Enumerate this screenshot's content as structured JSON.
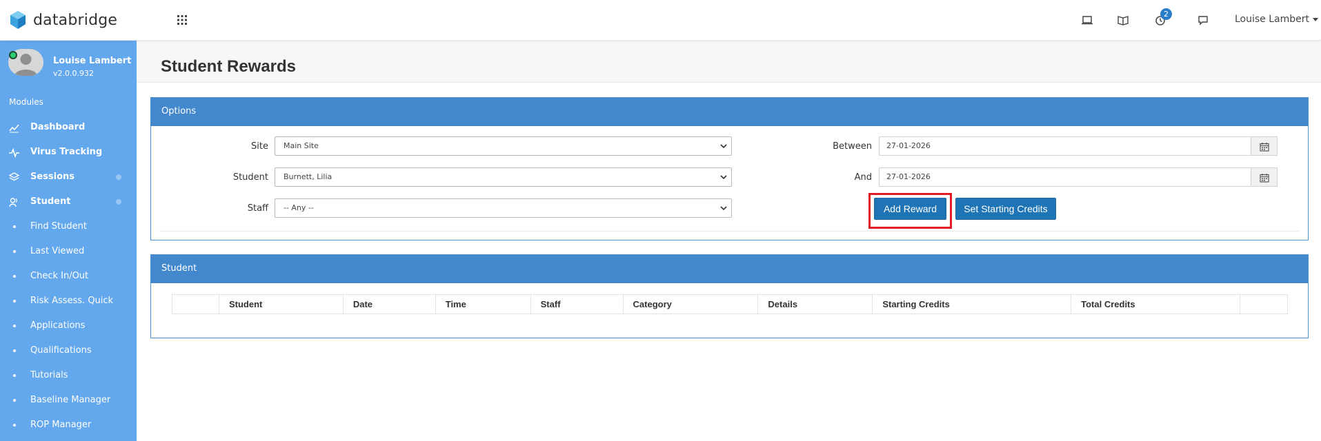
{
  "app": {
    "brand_name": "databridge"
  },
  "topbar": {
    "notification_count": "2",
    "user_name": "Louise Lambert",
    "icons": [
      "grid-icon",
      "laptop-icon",
      "book-icon",
      "clock-icon",
      "chat-icon"
    ]
  },
  "sidebar": {
    "profile_name": "Louise Lambert",
    "version": "v2.0.0.932",
    "modules_label": "Modules",
    "items": [
      {
        "label": "Dashboard",
        "icon": "chart-line-icon"
      },
      {
        "label": "Virus Tracking",
        "icon": "pulse-icon"
      },
      {
        "label": "Sessions",
        "icon": "layers-icon"
      },
      {
        "label": "Student",
        "icon": "users-icon"
      }
    ],
    "sub_items": [
      "Find Student",
      "Last Viewed",
      "Check In/Out",
      "Risk Assess. Quick",
      "Applications",
      "Qualifications",
      "Tutorials",
      "Baseline Manager",
      "ROP Manager"
    ]
  },
  "page": {
    "title": "Student Rewards"
  },
  "options": {
    "heading": "Options",
    "site_label": "Site",
    "site_value": "Main Site",
    "student_label": "Student",
    "student_value": "Burnett, Lilia",
    "staff_label": "Staff",
    "staff_value": "-- Any --",
    "between_label": "Between",
    "between_value": "27-01-2026",
    "and_label": "And",
    "and_value": "27-01-2026",
    "add_reward_label": "Add Reward",
    "set_credits_label": "Set Starting Credits"
  },
  "results": {
    "heading": "Student",
    "columns": [
      "",
      "Student",
      "Date",
      "Time",
      "Staff",
      "Category",
      "Details",
      "Starting Credits",
      "Total Credits",
      ""
    ]
  },
  "colors": {
    "sidebar": "#63a7ec",
    "panel_header": "#4388cc",
    "button": "#1e74b5",
    "highlight": "#e01b24"
  }
}
